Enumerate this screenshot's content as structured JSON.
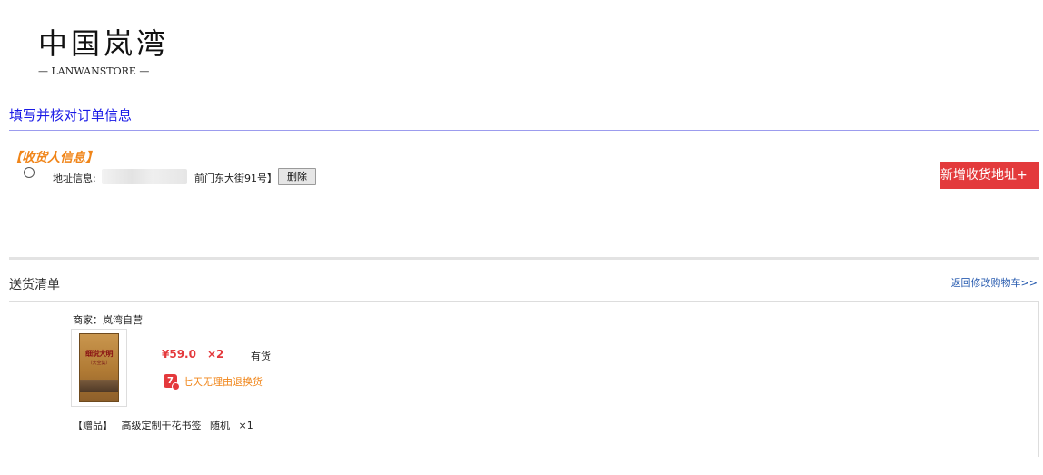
{
  "brand": {
    "logo_text": "中国岚湾",
    "logo_sub": "— LANWANSTORE —"
  },
  "page": {
    "heading": "填写并核对订单信息"
  },
  "receiver": {
    "section_label": "【收货人信息】",
    "address_label": "地址信息:",
    "address_text": "前门东大街91号】",
    "delete_label": "删除",
    "add_address_label": "新增收货地址+"
  },
  "shipping": {
    "title": "送货清单",
    "back_link": "返回修改购物车>>",
    "merchant": "商家：岚湾自营",
    "item": {
      "cover_title": "细说大明",
      "cover_sub": "（大全集）",
      "price": "¥59.0",
      "quantity": "×2",
      "stock": "有货",
      "return_icon_text": "7",
      "return_policy": "七天无理由退换货"
    },
    "gift": {
      "tag": "【赠品】",
      "name": "高级定制干花书签",
      "variant": "随机",
      "quantity": "×1"
    }
  },
  "colors": {
    "accent_red": "#e33a3c",
    "heading_blue": "#1a1ae6",
    "tag_orange": "#f08519",
    "link_blue": "#2a5db0"
  },
  "icons": [
    "radio-icon",
    "book-cover-image",
    "seven-day-return-icon"
  ]
}
